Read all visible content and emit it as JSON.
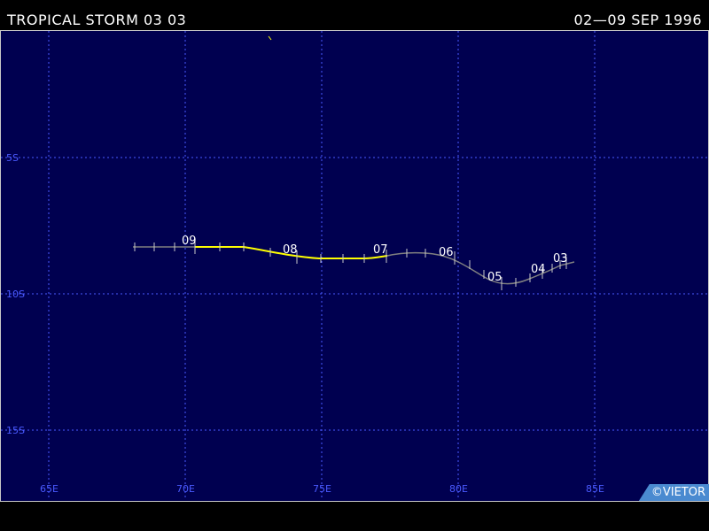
{
  "header": {
    "storm_name": "TROPICAL STORM 03 03",
    "date_range": "02—09 SEP 1996"
  },
  "map": {
    "background_color": "#000050",
    "grid_color": "#4a5aff",
    "grid_style": "dotted",
    "lon_labels": [
      "65E",
      "70E",
      "75E",
      "80E",
      "85E"
    ],
    "lat_labels": [
      "5S",
      "10S",
      "15S"
    ]
  },
  "track": {
    "colors": {
      "storm": "#ffff00",
      "depression": "#808080"
    },
    "day_labels": [
      "03",
      "04",
      "05",
      "06",
      "07",
      "08",
      "09"
    ]
  },
  "credit": "©VIETOR"
}
